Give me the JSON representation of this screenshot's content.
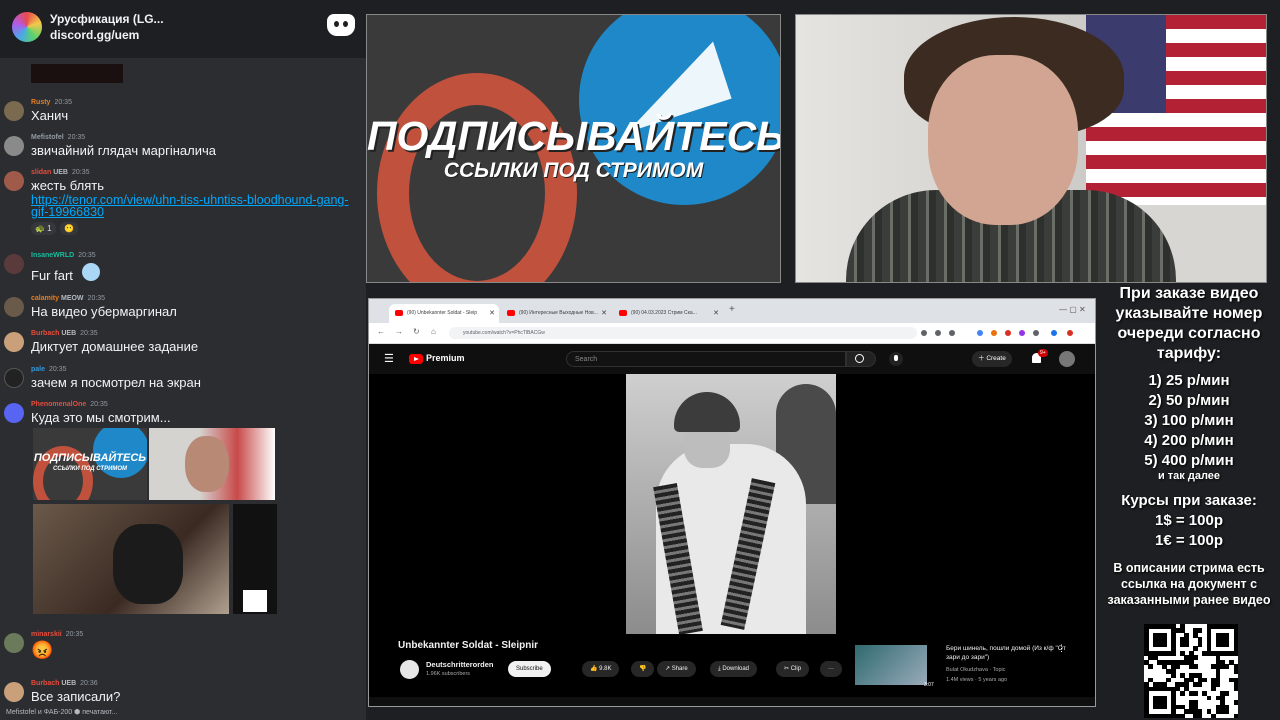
{
  "chat": {
    "server_name": "Урусфикация (LG...",
    "invite": "discord.gg/uem",
    "messages": [
      {
        "user": "Rusty",
        "user_color": "#e67e22",
        "time": "20:35",
        "text": "Ханич",
        "avatar": "#7a6a50"
      },
      {
        "user": "Mefistofel",
        "user_color": "#949ba4",
        "time": "20:35",
        "text": "звичайний глядач маргіналича",
        "avatar": "#8a8a8a"
      },
      {
        "user": "slidan",
        "user_color": "#e74c3c",
        "badge": "UEB",
        "time": "20:35",
        "text": "жесть блять",
        "avatar": "#a05a4a"
      },
      {
        "user": "InsaneWRLD",
        "user_color": "#1abc9c",
        "time": "20:35",
        "text": "Fur fart",
        "avatar": "#5a3a3a"
      },
      {
        "user": "calamity",
        "user_color": "#e67e22",
        "badge": "MEOW",
        "time": "20:35",
        "text": "На видео убермаргинал",
        "avatar": "#6a5a4a"
      },
      {
        "user": "Burbach",
        "user_color": "#e74c3c",
        "badge": "UEB",
        "time": "20:35",
        "text": "Диктует домашнее задание",
        "avatar": "#c9a07a"
      },
      {
        "user": "pale",
        "user_color": "#3498db",
        "time": "20:35",
        "text": "зачем я посмотрел на экран",
        "avatar": "#222222"
      },
      {
        "user": "PhenomenalOne",
        "user_color": "#e74c3c",
        "time": "20:35",
        "text": "Куда это мы смотрим...",
        "avatar": "#5865f2"
      },
      {
        "user": "minarskii",
        "user_color": "#e74c3c",
        "time": "20:35",
        "text": "😡",
        "avatar": "#6a7a5a"
      },
      {
        "user": "Burbach",
        "user_color": "#e74c3c",
        "badge": "UEB",
        "time": "20:36",
        "text": "Все записали?",
        "avatar": "#c9a07a"
      }
    ],
    "link": "https://tenor.com/view/uhn-tiss-uhntiss-bloodhound-gang-gif-19966830",
    "reactions": [
      "🐢 1",
      "😶"
    ],
    "typing": "Mefistofel и ФАБ-200 ⬢ печатают..."
  },
  "banner": {
    "title": "ПОДПИСЫВАЙТЕСЬ",
    "subtitle": "ССЫЛКИ ПОД СТРИМОМ"
  },
  "browser": {
    "tabs": [
      "(90) Unbekannter Soldat - Sleip",
      "(90) Интересные Выходные Нов...",
      "(90) 04.03.2023 Стрим Ска..."
    ],
    "url": "youtube.com/watch?v=PhcTlBACGw",
    "youtube": {
      "premium_label": "Premium",
      "search_placeholder": "Search",
      "create_label": "Create",
      "notif_count": "9+",
      "video_title": "Unbekannter Soldat - Sleipnir",
      "channel": "Deutschritterorden",
      "subscribers": "1.96K subscribers",
      "subscribe_label": "Subscribe",
      "likes": "9.8K",
      "share_label": "Share",
      "download_label": "Download",
      "clip_label": "Clip",
      "more_label": "···",
      "rec_title": "Бери шинель, пошли домой (Из к/ф \"От зари до зари\")",
      "rec_channel": "Bulat Okudzhava · Topic",
      "rec_stats": "1.4M views · 5 years ago",
      "rec_duration": "3:07"
    }
  },
  "right_panel": {
    "order_text": "При заказе видео указывайте номер очереди согласно тарифу:",
    "tariffs": [
      "1) 25 р/мин",
      "2) 50 р/мин",
      "3) 100 р/мин",
      "4) 200 р/мин",
      "5) 400 р/мин"
    ],
    "and_so_on": "и так далее",
    "rates_title": "Курсы при заказе:",
    "rates": [
      "1$ = 100р",
      "1€ = 100р"
    ],
    "description_note": "В описании стрима есть ссылка на документ с заказанными ранее видео"
  },
  "colors": {
    "chat_bg": "#2b2d31",
    "link": "#00a8fc",
    "youtube_red": "#ff0000",
    "banner_orange": "#c0513c",
    "telegram_blue": "#1e88c8"
  }
}
